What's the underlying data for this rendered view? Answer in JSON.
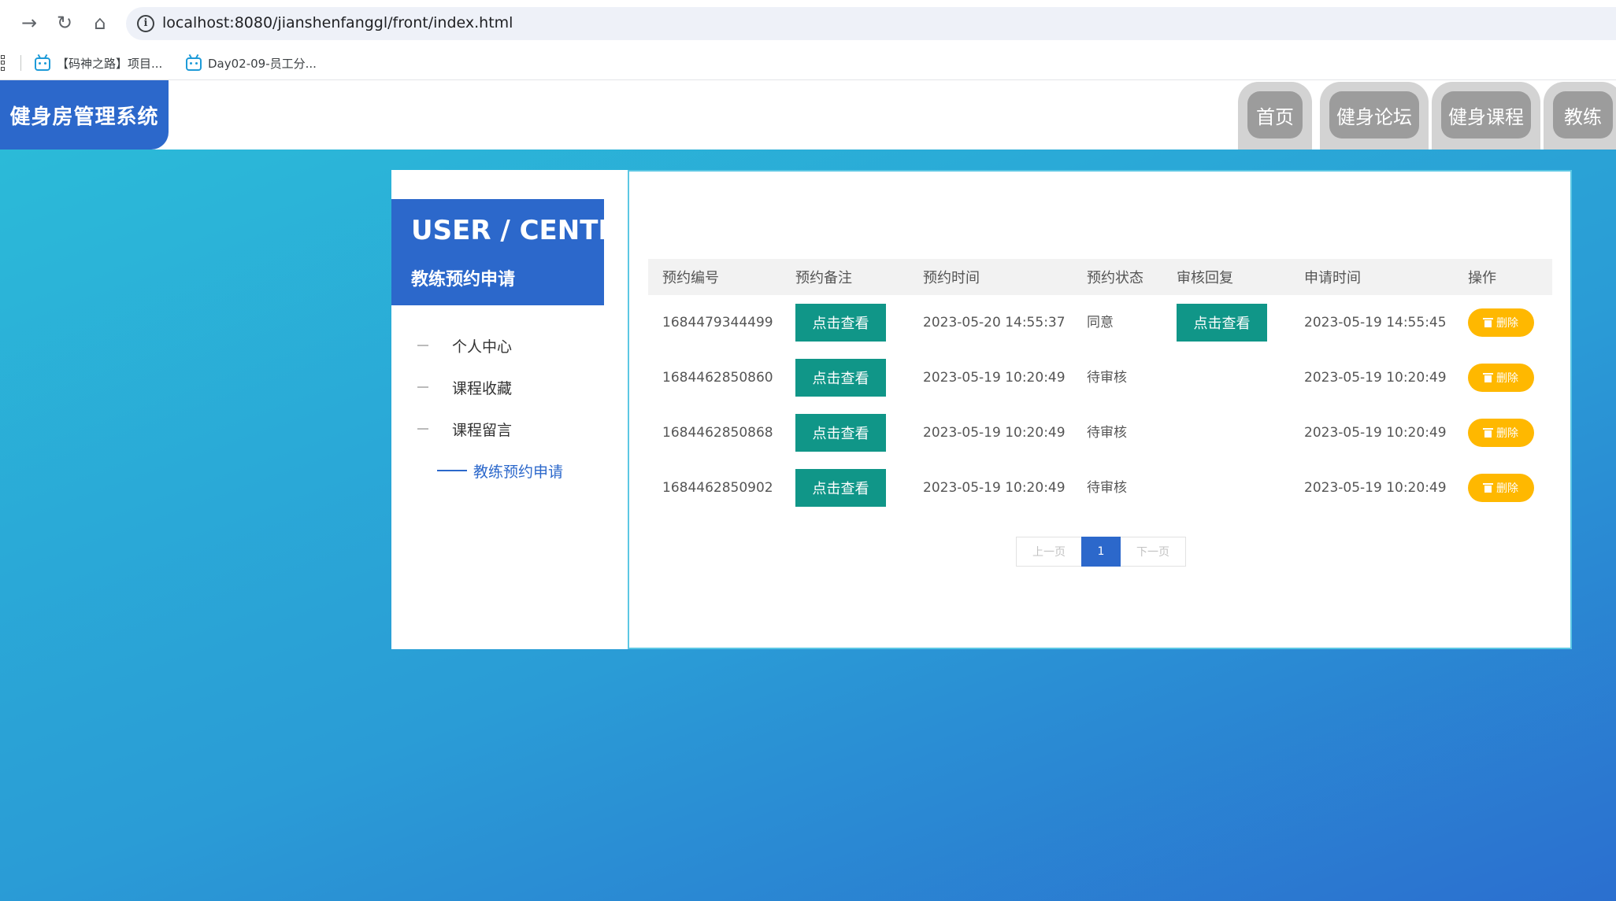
{
  "browser": {
    "url": "localhost:8080/jianshenfanggl/front/index.html",
    "bookmarks": [
      "【码神之路】项目...",
      "Day02-09-员工分..."
    ],
    "icons": [
      "back-arrow-icon",
      "reload-icon",
      "home-icon",
      "site-info-icon",
      "apps-icon",
      "bilibili-icon"
    ]
  },
  "header": {
    "logo": "健身房管理系统",
    "nav": [
      "首页",
      "健身论坛",
      "健身课程",
      "教练"
    ]
  },
  "sidebar": {
    "title": "USER / CENTER",
    "subtitle": "教练预约申请",
    "items": [
      "个人中心",
      "课程收藏",
      "课程留言"
    ],
    "active_item": "教练预约申请"
  },
  "table": {
    "columns": [
      "预约编号",
      "预约备注",
      "预约时间",
      "预约状态",
      "审核回复",
      "申请时间",
      "操作"
    ],
    "view_label": "点击查看",
    "delete_label": "删除",
    "rows": [
      {
        "id": "1684479344499",
        "time": "2023-05-20 14:55:37",
        "status": "同意",
        "reply": "点击查看",
        "applied": "2023-05-19 14:55:45"
      },
      {
        "id": "1684462850860",
        "time": "2023-05-19 10:20:49",
        "status": "待审核",
        "reply": "",
        "applied": "2023-05-19 10:20:49"
      },
      {
        "id": "1684462850868",
        "time": "2023-05-19 10:20:49",
        "status": "待审核",
        "reply": "",
        "applied": "2023-05-19 10:20:49"
      },
      {
        "id": "1684462850902",
        "time": "2023-05-19 10:20:49",
        "status": "待审核",
        "reply": "",
        "applied": "2023-05-19 10:20:49"
      }
    ]
  },
  "pagination": {
    "prev": "上一页",
    "current": "1",
    "next": "下一页"
  },
  "colors": {
    "primary": "#2c68cb",
    "view_button": "#109688",
    "delete_button": "#ffb800",
    "background_gradient": [
      "#2bbad8",
      "#2b6fcf"
    ]
  }
}
